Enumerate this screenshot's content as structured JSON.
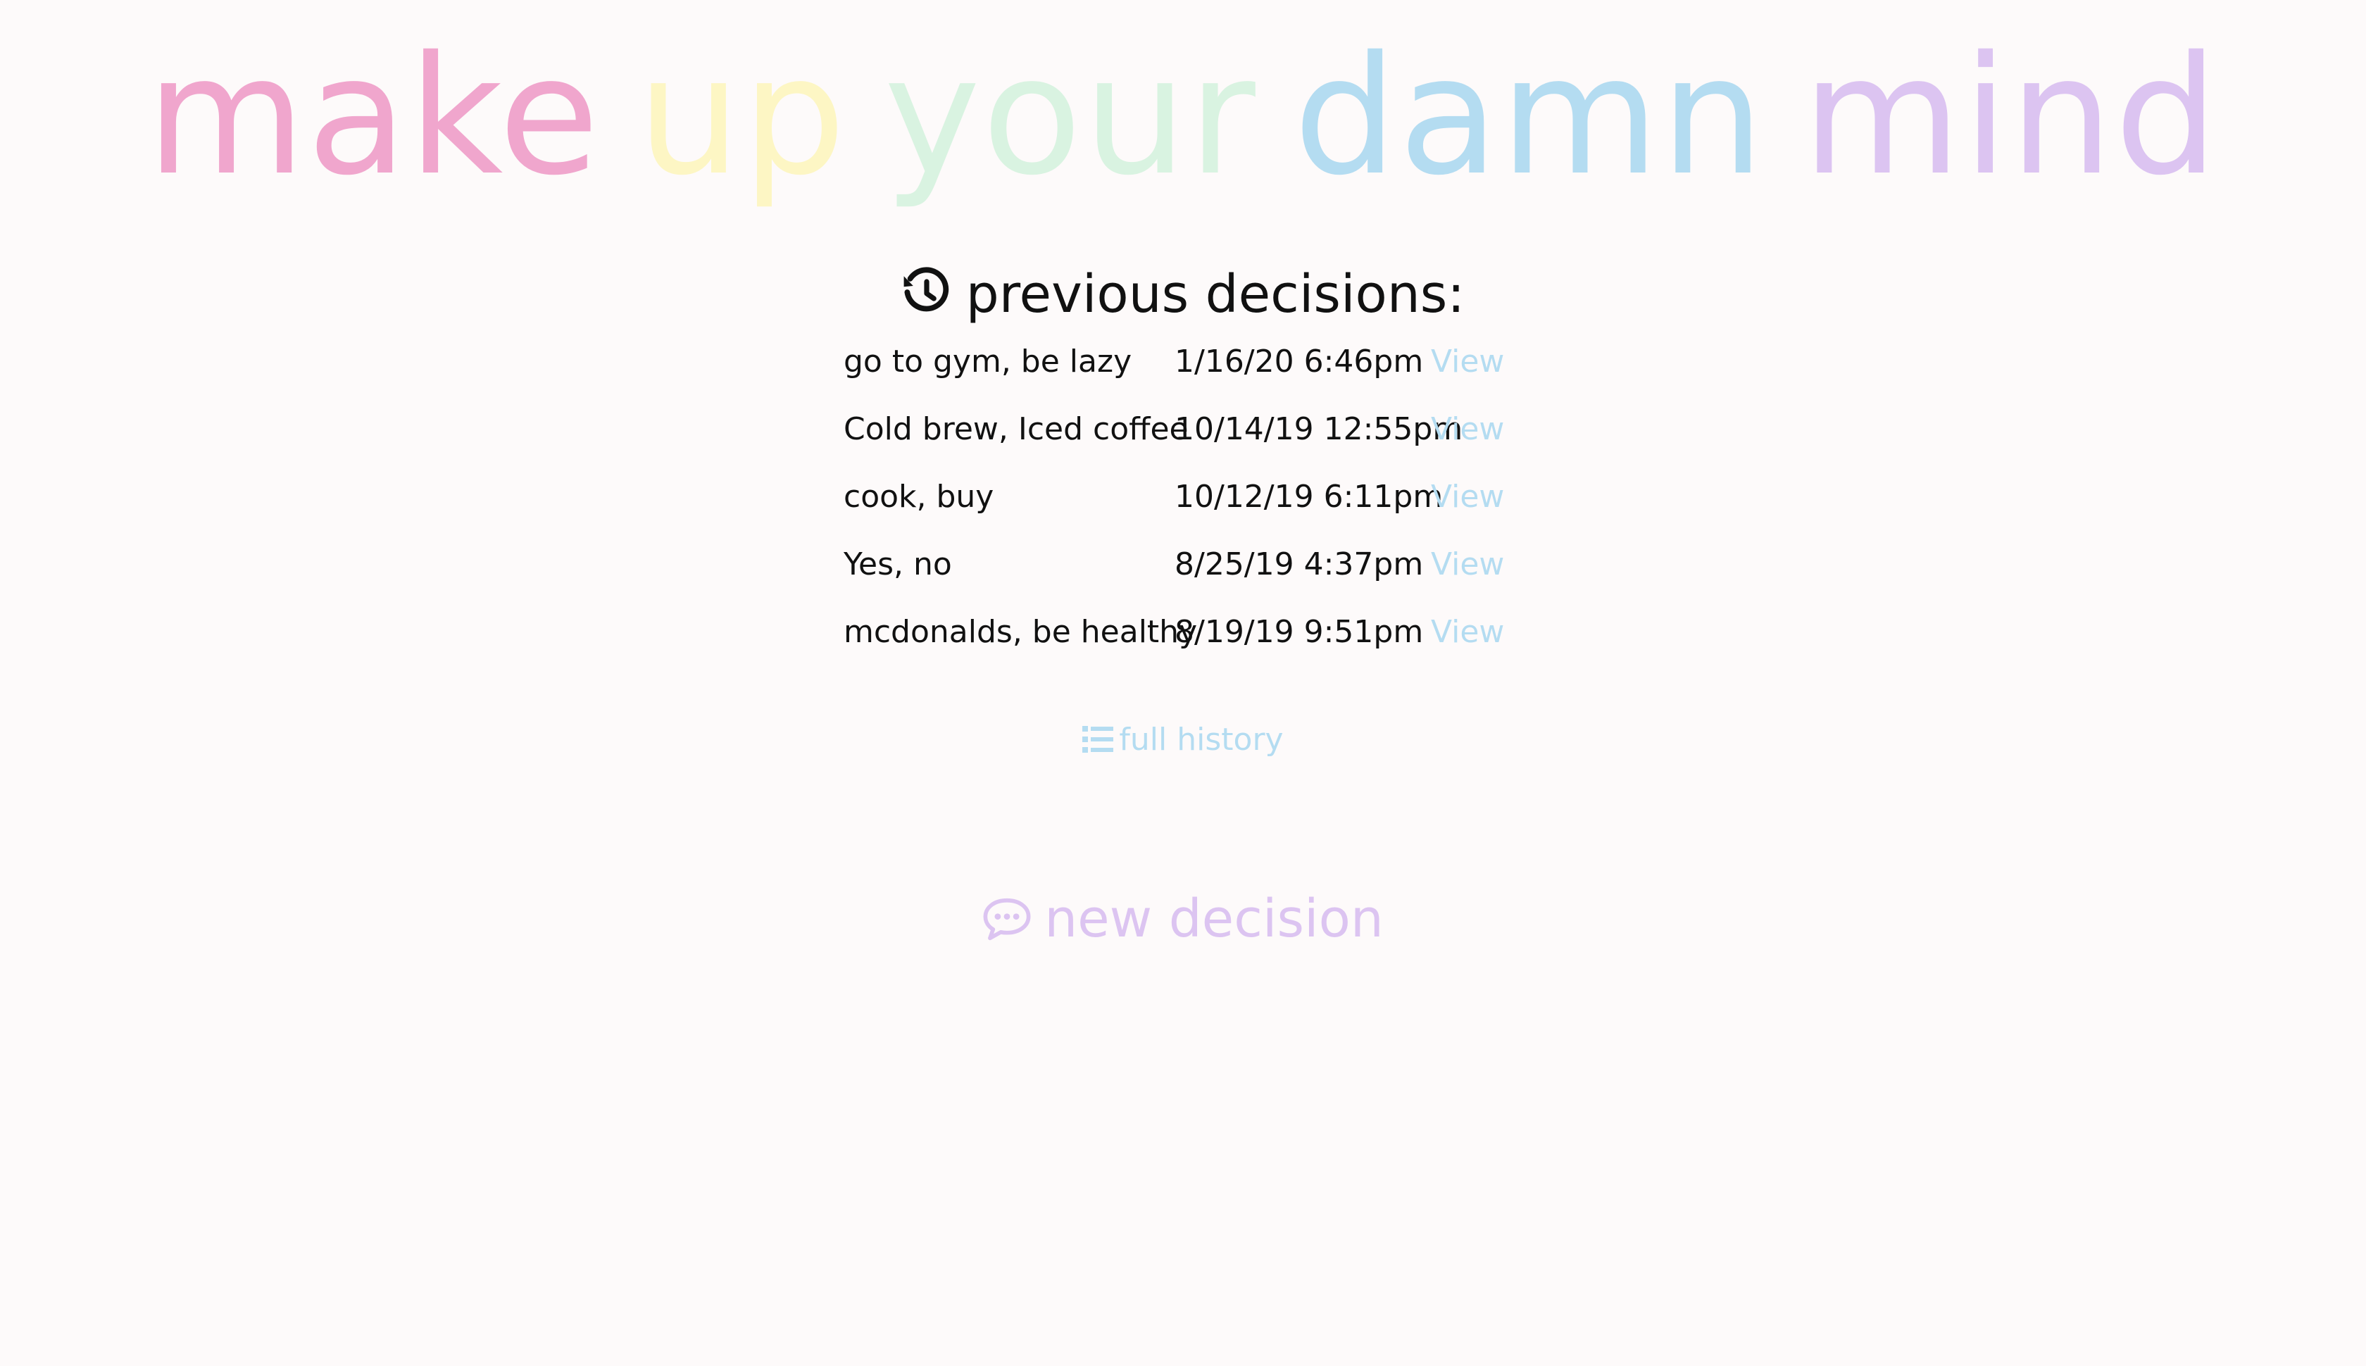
{
  "header": {
    "title_words": [
      {
        "text": "make",
        "color": "#f0a6cd"
      },
      {
        "text": "up",
        "color": "#fdf6c4"
      },
      {
        "text": "your",
        "color": "#d9f3e1"
      },
      {
        "text": "damn",
        "color": "#b4dcf1"
      },
      {
        "text": "mind",
        "color": "#dcc4f1"
      }
    ]
  },
  "history": {
    "heading": "previous decisions:",
    "icon": "history-icon",
    "rows": [
      {
        "options": "go to gym, be lazy",
        "date": "1/16/20 6:46pm",
        "link": "View"
      },
      {
        "options": "Cold brew, Iced coffee",
        "date": "10/14/19 12:55pm",
        "link": "View"
      },
      {
        "options": "cook, buy",
        "date": "10/12/19 6:11pm",
        "link": "View"
      },
      {
        "options": "Yes, no",
        "date": "8/25/19 4:37pm",
        "link": "View"
      },
      {
        "options": "mcdonalds, be healthy",
        "date": "8/19/19 9:51pm",
        "link": "View"
      }
    ],
    "full_history_label": "full history",
    "full_history_icon": "list-icon"
  },
  "new_decision": {
    "label": "new decision",
    "icon": "chat-bubble-icon"
  },
  "colors": {
    "background": "#fdfafa",
    "link_blue": "#b4dcf1",
    "purple": "#dcc4f1",
    "text": "#111111"
  }
}
